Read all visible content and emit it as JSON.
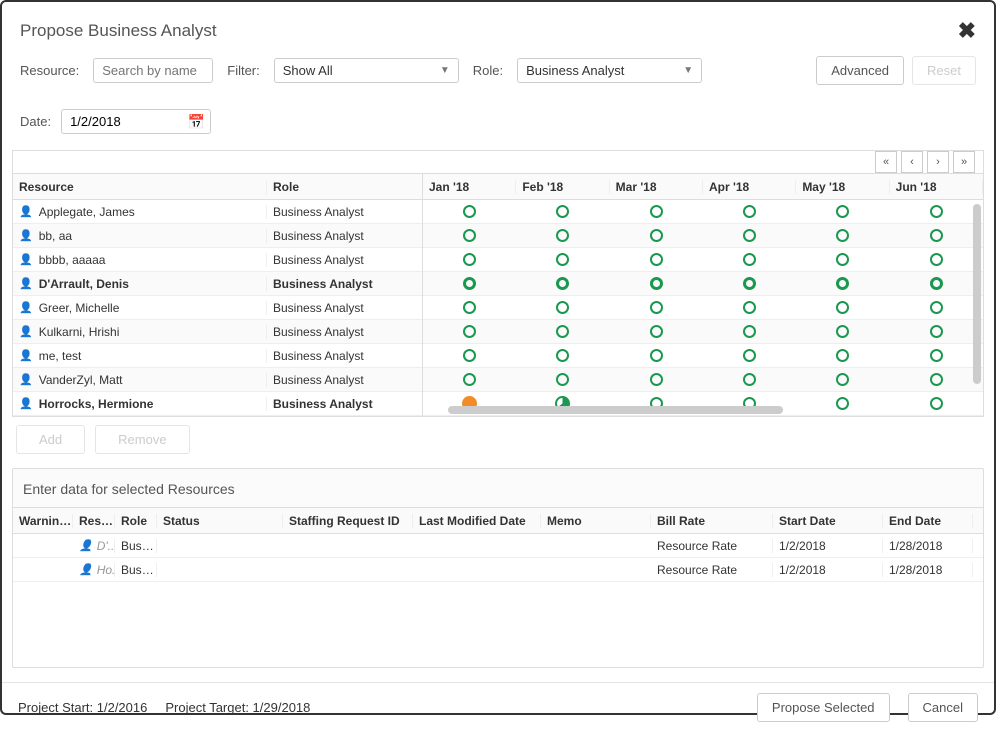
{
  "dialog": {
    "title": "Propose Business Analyst"
  },
  "filters": {
    "resource_label": "Resource:",
    "resource_placeholder": "Search by name",
    "filter_label": "Filter:",
    "filter_value": "Show All",
    "role_label": "Role:",
    "role_value": "Business Analyst",
    "advanced": "Advanced",
    "reset": "Reset",
    "date_label": "Date:",
    "date_value": "1/2/2018"
  },
  "grid": {
    "headers": {
      "resource": "Resource",
      "role": "Role"
    },
    "months": [
      "Jan '18",
      "Feb '18",
      "Mar '18",
      "Apr '18",
      "May '18",
      "Jun '18"
    ],
    "rows": [
      {
        "name": "Applegate, James",
        "role": "Business Analyst",
        "bold": false,
        "cells": [
          "open",
          "open",
          "open",
          "open",
          "open",
          "open"
        ]
      },
      {
        "name": "bb, aa",
        "role": "Business Analyst",
        "bold": false,
        "cells": [
          "open",
          "open",
          "open",
          "open",
          "open",
          "open"
        ]
      },
      {
        "name": "bbbb, aaaaa",
        "role": "Business Analyst",
        "bold": false,
        "cells": [
          "open",
          "open",
          "open",
          "open",
          "open",
          "open"
        ]
      },
      {
        "name": "D'Arrault, Denis",
        "role": "Business Analyst",
        "bold": true,
        "cells": [
          "thick",
          "thick",
          "thick",
          "thick",
          "thick",
          "thick"
        ]
      },
      {
        "name": "Greer, Michelle",
        "role": "Business Analyst",
        "bold": false,
        "cells": [
          "open",
          "open",
          "open",
          "open",
          "open",
          "open"
        ]
      },
      {
        "name": "Kulkarni, Hrishi",
        "role": "Business Analyst",
        "bold": false,
        "cells": [
          "open",
          "open",
          "open",
          "open",
          "open",
          "open"
        ]
      },
      {
        "name": "me, test",
        "role": "Business Analyst",
        "bold": false,
        "cells": [
          "open",
          "open",
          "open",
          "open",
          "open",
          "open"
        ]
      },
      {
        "name": "VanderZyl, Matt",
        "role": "Business Analyst",
        "bold": false,
        "cells": [
          "open",
          "open",
          "open",
          "open",
          "open",
          "open"
        ]
      },
      {
        "name": "Horrocks, Hermione",
        "role": "Business Analyst",
        "bold": true,
        "cells": [
          "full",
          "half",
          "open",
          "open",
          "open",
          "open"
        ]
      }
    ]
  },
  "actions": {
    "add": "Add",
    "remove": "Remove"
  },
  "bottom": {
    "title": "Enter data for selected Resources",
    "headers": {
      "warnings": "Warnings",
      "resource": "Reso...",
      "role": "Role",
      "status": "Status",
      "sri": "Staffing Request ID",
      "lmd": "Last Modified Date",
      "memo": "Memo",
      "bill": "Bill Rate",
      "sd": "Start Date",
      "ed": "End Date"
    },
    "rows": [
      {
        "resource": "D'...",
        "role": "Busin...",
        "bill": "Resource Rate",
        "sd": "1/2/2018",
        "ed": "1/28/2018"
      },
      {
        "resource": "Ho...",
        "role": "Busin...",
        "bill": "Resource Rate",
        "sd": "1/2/2018",
        "ed": "1/28/2018"
      }
    ]
  },
  "footer": {
    "project_start": "Project Start: 1/2/2016",
    "project_target": "Project Target: 1/29/2018",
    "propose": "Propose Selected",
    "cancel": "Cancel"
  }
}
